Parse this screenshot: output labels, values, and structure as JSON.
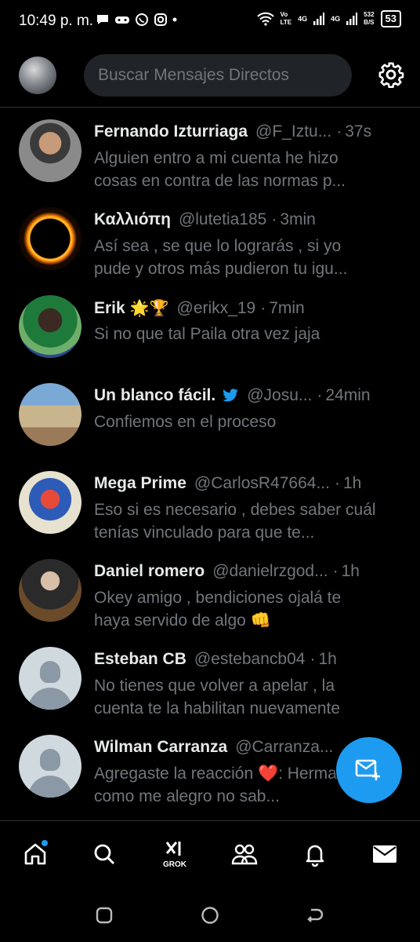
{
  "status_bar": {
    "time": "10:49 p. m.",
    "volte": "Vo\nLTE",
    "net1": "4G",
    "net2": "4G",
    "speed": "532\nB/S",
    "battery": "53"
  },
  "header": {
    "search_placeholder": "Buscar Mensajes Directos"
  },
  "conversations": [
    {
      "name": "Fernando Izturriaga",
      "handle": "@F_Iztu...",
      "time": "37s",
      "message": "Alguien entro a mi cuenta he hizo cosas en contra de las normas p..."
    },
    {
      "name": "Καλλιόπη",
      "handle": "@lutetia185",
      "time": "3min",
      "message": "Así sea , se que lo lograrás , si yo pude y otros más pudieron tu igu..."
    },
    {
      "name": "Erik",
      "name_emojis": "🌟🏆",
      "handle": "@erikx_19",
      "time": "7min",
      "message": "Si no que tal Paila otra vez jaja"
    },
    {
      "name": "Un blanco fácil.",
      "handle": "@Josu...",
      "time": "24min",
      "message": "Confiemos en el proceso"
    },
    {
      "name": "Mega Prime",
      "handle": "@CarlosR47664...",
      "time": "1h",
      "message": "Eso si es necesario , debes saber cuál tenías vinculado para que te..."
    },
    {
      "name": "Daniel romero",
      "handle": "@danielrzgod...",
      "time": "1h",
      "message": "Okey amigo , bendiciones ojalá te haya servido de algo 👊"
    },
    {
      "name": "Esteban CB",
      "handle": "@estebancb04",
      "time": "1h",
      "message": "No tienes que volver a apelar , la cuenta te la habilitan nuevamente"
    },
    {
      "name": "Wilman Carranza",
      "handle": "@Carranza...",
      "time": "",
      "message": "Agregaste la reacción ❤️: Hermano como me alegro no sab..."
    }
  ],
  "bottom_nav": {
    "grok_label": "GROK"
  },
  "colors": {
    "accent": "#1d9bf0",
    "background": "#000000",
    "secondary_text": "#71767b"
  }
}
